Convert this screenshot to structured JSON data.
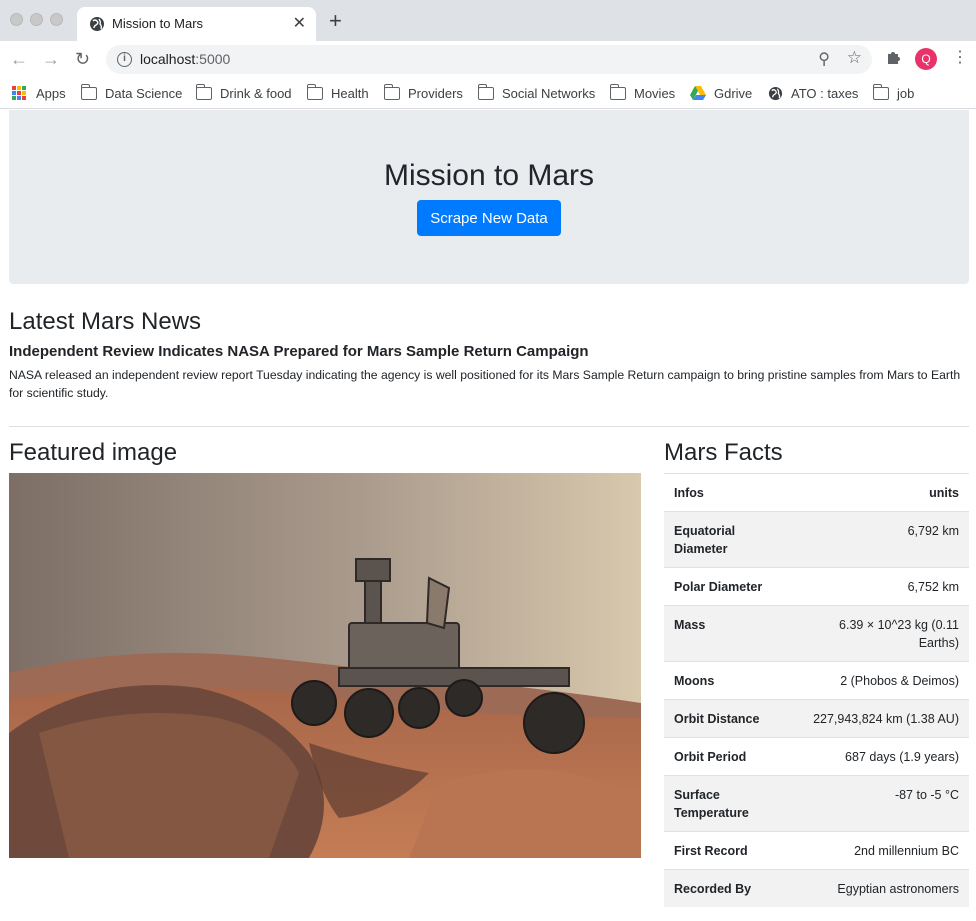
{
  "browser": {
    "tab_title": "Mission to Mars",
    "url_host": "localhost",
    "url_port": ":5000",
    "avatar_letter": "Q",
    "bookmarks": [
      "Apps",
      "Data Science",
      "Drink & food",
      "Health",
      "Providers",
      "Social Networks",
      "Movies",
      "Gdrive",
      "ATO : taxes",
      "job"
    ]
  },
  "jumbotron": {
    "title": "Mission to Mars",
    "button_label": "Scrape New Data"
  },
  "news": {
    "heading": "Latest Mars News",
    "title": "Independent Review Indicates NASA Prepared for Mars Sample Return Campaign",
    "body": "NASA released an independent review report Tuesday indicating the agency is well positioned for its Mars Sample Return campaign to bring pristine samples from Mars to Earth for scientific study."
  },
  "featured": {
    "heading": "Featured image"
  },
  "facts": {
    "heading": "Mars Facts",
    "header": [
      "Infos",
      "units"
    ],
    "rows": [
      [
        "Equatorial Diameter",
        "6,792 km"
      ],
      [
        "Polar Diameter",
        "6,752 km"
      ],
      [
        "Mass",
        "6.39 × 10^23 kg (0.11 Earths)"
      ],
      [
        "Moons",
        "2 (Phobos & Deimos)"
      ],
      [
        "Orbit Distance",
        "227,943,824 km (1.38 AU)"
      ],
      [
        "Orbit Period",
        "687 days (1.9 years)"
      ],
      [
        "Surface Temperature",
        "-87 to -5 °C"
      ],
      [
        "First Record",
        "2nd millennium BC"
      ],
      [
        "Recorded By",
        "Egyptian astronomers"
      ]
    ]
  },
  "colors": {
    "primary": "#007bff",
    "jumbotron_bg": "#e9ecef"
  }
}
